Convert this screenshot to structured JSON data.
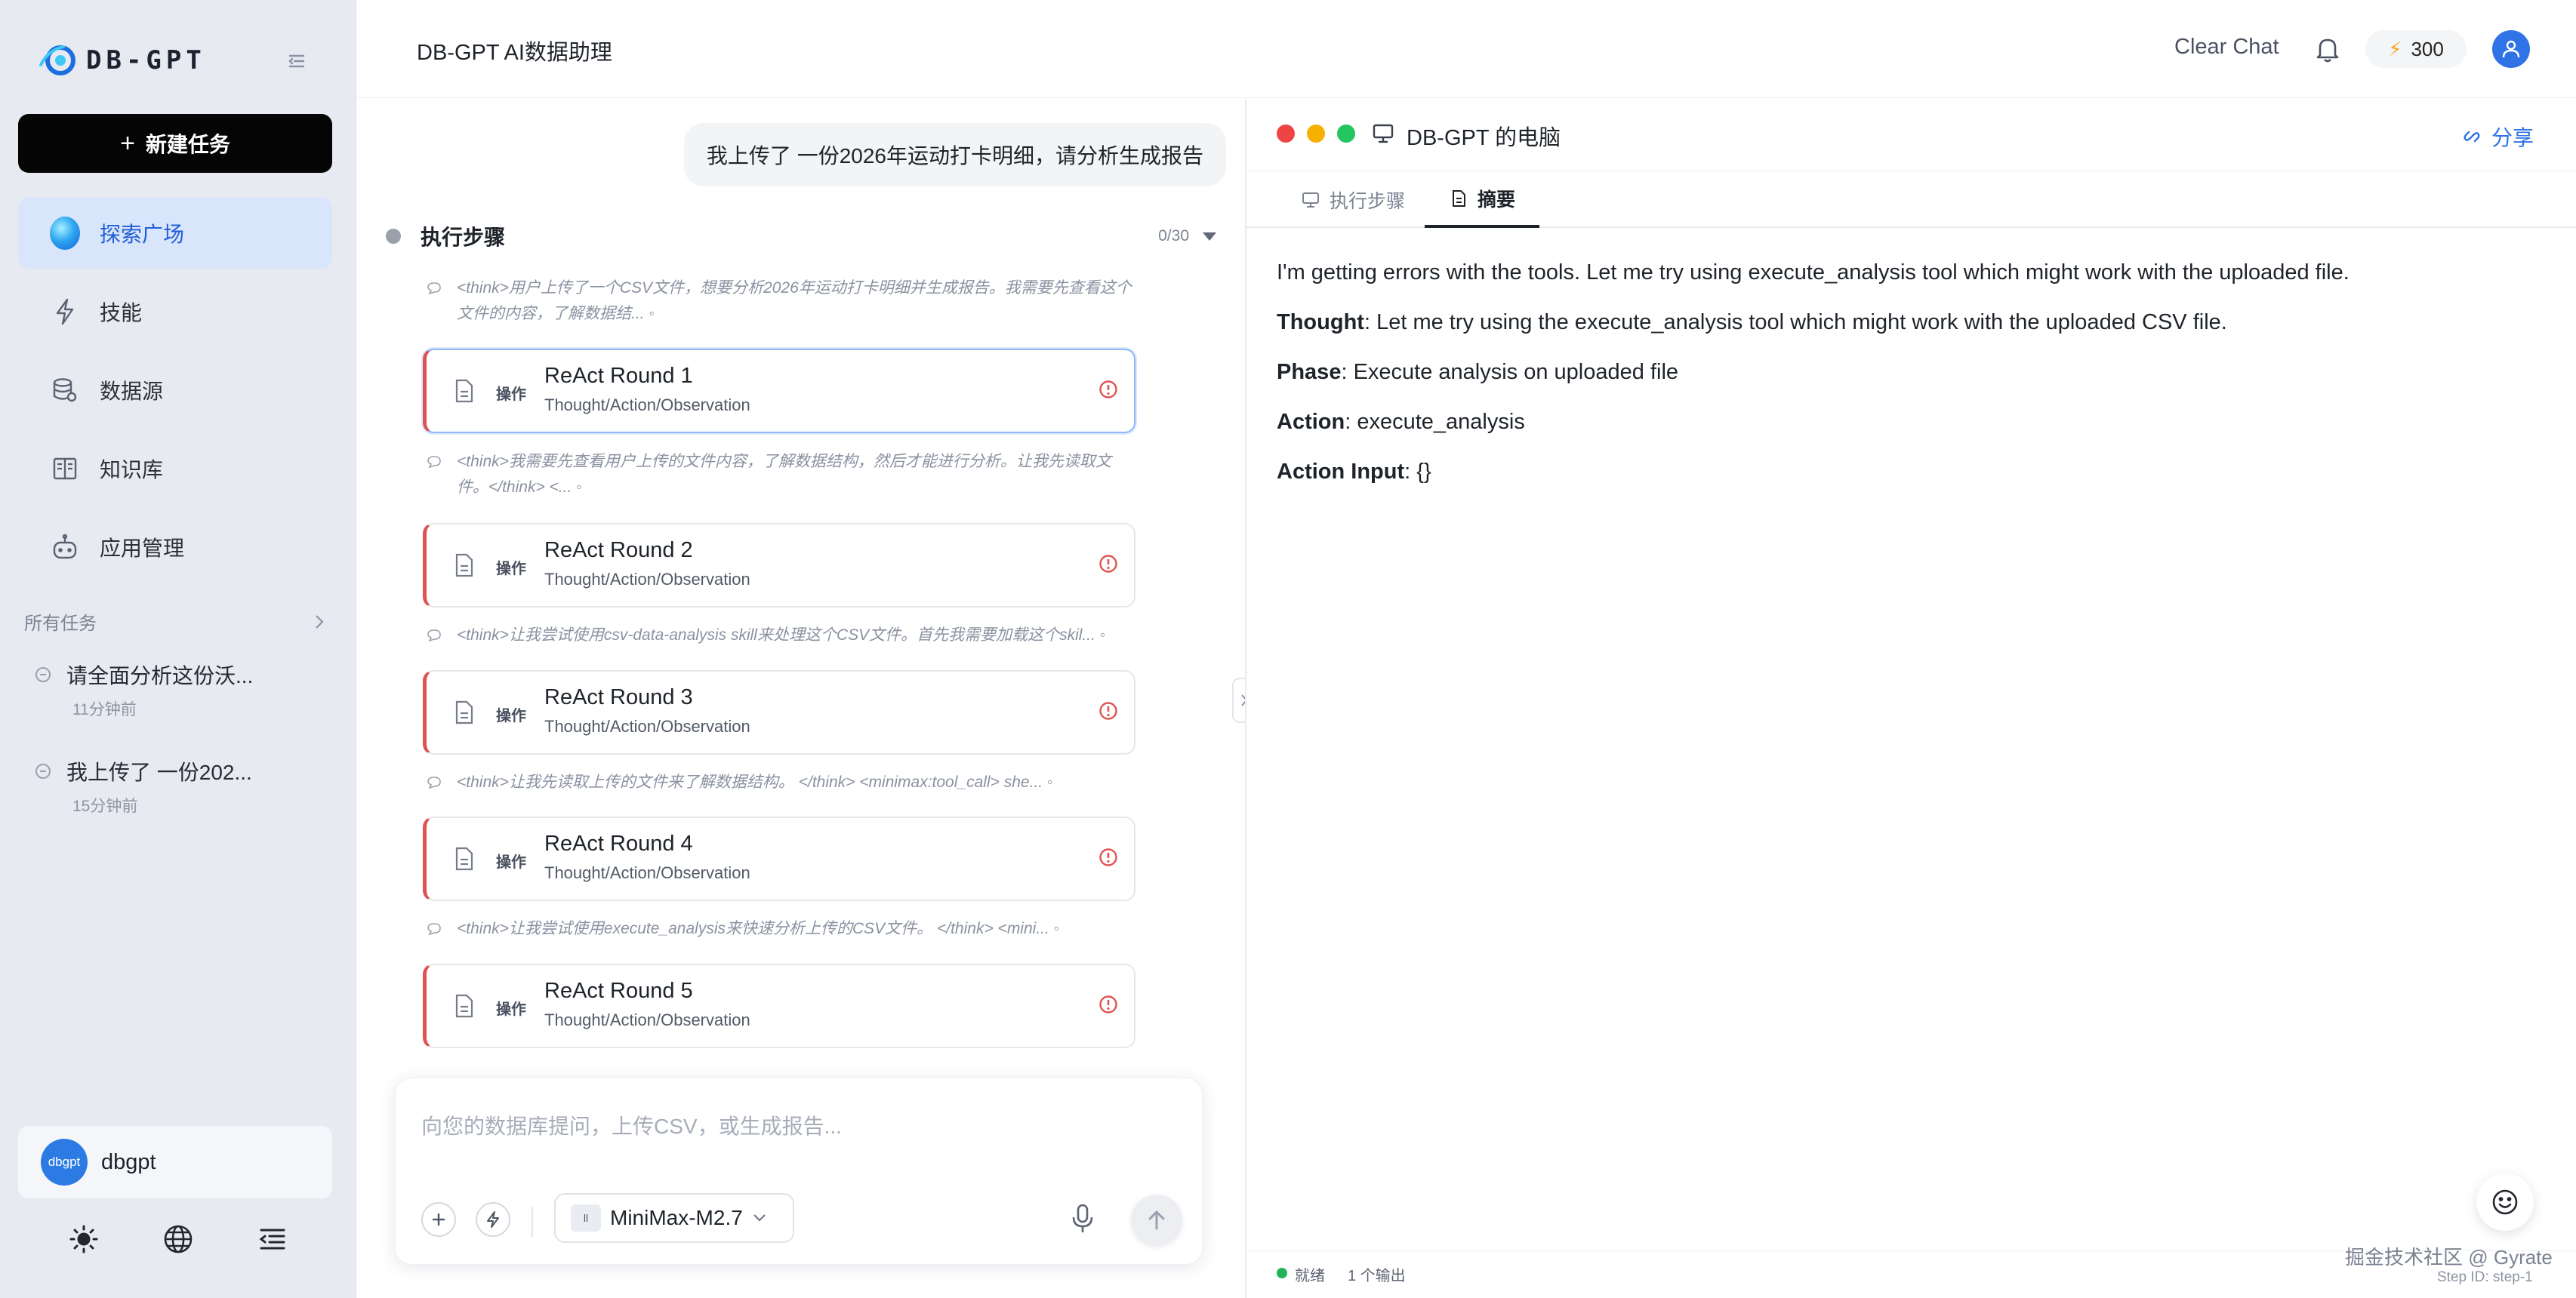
{
  "sidebar": {
    "logo_text": "DB-GPT",
    "new_task_label": "新建任务",
    "nav": [
      {
        "label": "探索广场",
        "icon": "explore-orb-icon",
        "active": true
      },
      {
        "label": "技能",
        "icon": "lightning-icon"
      },
      {
        "label": "数据源",
        "icon": "database-icon"
      },
      {
        "label": "知识库",
        "icon": "book-icon"
      },
      {
        "label": "应用管理",
        "icon": "robot-icon"
      }
    ],
    "all_tasks_label": "所有任务",
    "tasks": [
      {
        "title": "请全面分析这份沃...",
        "time": "11分钟前"
      },
      {
        "title": "我上传了 一份202...",
        "time": "15分钟前"
      }
    ],
    "user": {
      "avatar_text": "dbgpt",
      "name": "dbgpt"
    }
  },
  "topbar": {
    "title": "DB-GPT AI数据助理",
    "clear_chat": "Clear Chat",
    "credits": "300"
  },
  "chat": {
    "user_message": "我上传了 一份2026年运动打卡明细，请分析生成报告",
    "steps_label": "执行步骤",
    "steps_count": "0/30",
    "thinks": [
      "<think>用户上传了一个CSV文件，想要分析2026年运动打卡明细并生成报告。我需要先查看这个文件的内容，了解数据结... ◦",
      "<think>我需要先查看用户上传的文件内容，了解数据结构，然后才能进行分析。让我先读取文件。</think> <... ◦",
      "<think>让我尝试使用csv-data-analysis skill来处理这个CSV文件。首先我需要加载这个skil... ◦",
      "<think>让我先读取上传的文件来了解数据结构。 </think> <minimax:tool_call> she... ◦",
      "<think>让我尝试使用execute_analysis来快速分析上传的CSV文件。 </think> <mini... ◦"
    ],
    "rounds": [
      {
        "op": "操作",
        "name": "ReAct Round 1",
        "sub": "Thought/Action/Observation"
      },
      {
        "op": "操作",
        "name": "ReAct Round 2",
        "sub": "Thought/Action/Observation"
      },
      {
        "op": "操作",
        "name": "ReAct Round 3",
        "sub": "Thought/Action/Observation"
      },
      {
        "op": "操作",
        "name": "ReAct Round 4",
        "sub": "Thought/Action/Observation"
      },
      {
        "op": "操作",
        "name": "ReAct Round 5",
        "sub": "Thought/Action/Observation"
      }
    ],
    "input_placeholder": "向您的数据库提问，上传CSV，或生成报告...",
    "model": "MiniMax-M2.7",
    "model_logo_alt": "ll"
  },
  "panel": {
    "title": "DB-GPT 的电脑",
    "share": "分享",
    "tabs": [
      {
        "label": "执行步骤",
        "active": false
      },
      {
        "label": "摘要",
        "active": true
      }
    ],
    "content": {
      "intro": "I'm getting errors with the tools. Let me try using execute_analysis tool which might work with the uploaded file.",
      "thought_key": "Thought",
      "thought": ": Let me try using the execute_analysis tool which might work with the uploaded CSV file.",
      "phase_key": "Phase",
      "phase": ": Execute analysis on uploaded file",
      "action_key": "Action",
      "action": ": execute_analysis",
      "action_input_key": "Action Input",
      "action_input": ": {}"
    },
    "status": "就绪",
    "output_count": "1 个输出"
  },
  "watermark": {
    "line1": "掘金技术社区 @ Gyrate",
    "line2": "Step ID: step-1"
  },
  "colors": {
    "accent": "#2f73e6",
    "error": "#e05252",
    "ready": "#22b35a",
    "sidebar_bg": "#e7eaf1"
  }
}
